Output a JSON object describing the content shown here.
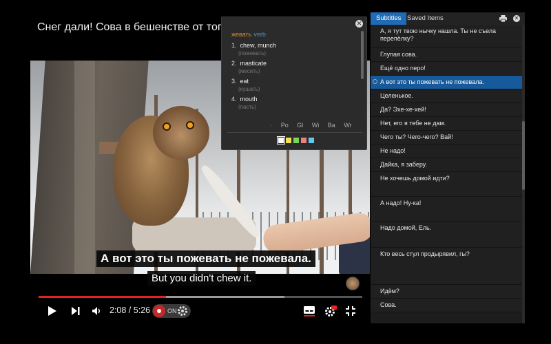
{
  "header": {
    "title": "Снег дали! Сова в бешенстве от того,"
  },
  "video": {
    "subtitle_ru": "А вот это ты пожевать не пожевала.",
    "subtitle_en": "But you didn't chew it."
  },
  "player": {
    "time_current": "2:08",
    "time_total": "5:26",
    "time_display": "2:08 / 5:26",
    "played_fraction": 0.393,
    "buffered_fraction": 0.76,
    "toggle_label": "ON",
    "colors": {
      "accent": "#e32222",
      "toggle": "#c62828"
    },
    "icons": [
      "play-icon",
      "next-icon",
      "volume-icon",
      "settings-icon",
      "subtitles-icon",
      "hd-settings-icon",
      "exit-fullscreen-icon"
    ]
  },
  "dictionary": {
    "word": "жевать",
    "part_of_speech": "verb",
    "entries": [
      {
        "num": "1.",
        "text": "chew, munch",
        "ru": "(пожевать)"
      },
      {
        "num": "2.",
        "text": "masticate",
        "ru": "(месить)"
      },
      {
        "num": "3.",
        "text": "eat",
        "ru": "(кушать)"
      },
      {
        "num": "4.",
        "text": "mouth",
        "ru": "(пасть)"
      }
    ],
    "sources": [
      "Po",
      "Gl",
      "Wi",
      "Ba",
      "Wr"
    ],
    "swatches": [
      "#ffffff",
      "#f4e04d",
      "#7ad45a",
      "#f08080",
      "#5ec8f0"
    ]
  },
  "sidebar": {
    "tabs": {
      "subtitles": "Subtitles",
      "saved": "Saved Items"
    },
    "accent": "#1f6bb5",
    "items": [
      "А, я тут твою нычку нашла. Ты не съела перепёлку?",
      "Глупая сова.",
      "Ещё одно перо!",
      "А вот это ты пожевать не пожевала.",
      "Целенькое.",
      "Да? Эхе-хе-хей!",
      "Нет, его я тебе не дам.",
      "Чего ты? Чего-чего? Вай!",
      "Не надо!",
      "Дайка, я заберу.",
      "Не хочешь домой идти?",
      "А надо! Ну-ка!",
      "Надо домой, Ель.",
      "Кто весь стул продырявил, гы?",
      "Идём?",
      "Сова."
    ],
    "active_index": 3
  }
}
